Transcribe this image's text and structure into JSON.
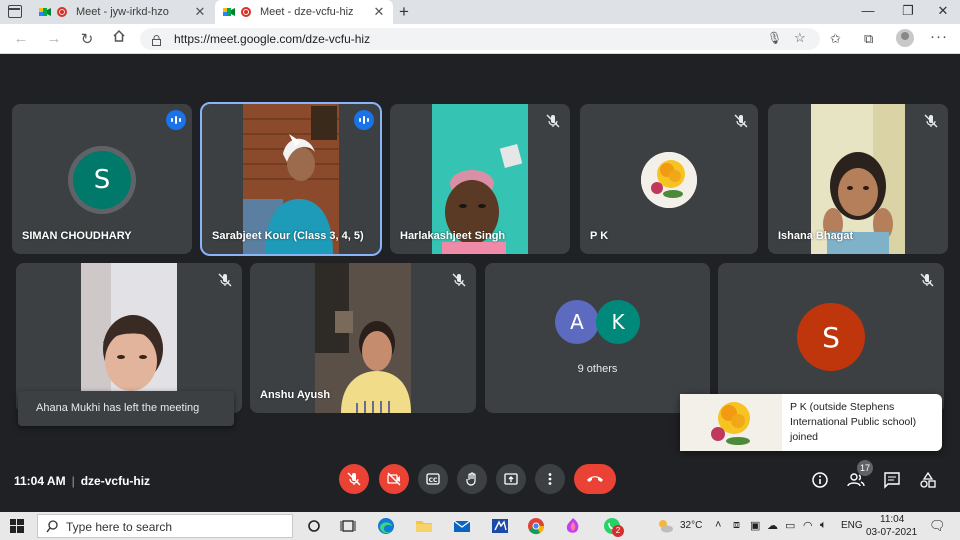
{
  "browser": {
    "tabs": [
      {
        "title": "Meet - jyw-irkd-hzo",
        "active": false
      },
      {
        "title": "Meet - dze-vcfu-hiz",
        "active": true
      }
    ],
    "url": "https://meet.google.com/dze-vcfu-hiz"
  },
  "participants": [
    {
      "name": "SIMAN CHOUDHARY",
      "avatar_letter": "S",
      "avatar_color": "#00796b",
      "status": "speaking"
    },
    {
      "name": "Sarabjeet Kour (Class 3, 4, 5)",
      "status": "speaking",
      "highlighted": true
    },
    {
      "name": "Harlakashjeet Singh",
      "status": "muted"
    },
    {
      "name": "P K",
      "status": "muted"
    },
    {
      "name": "Ishana Bhagat",
      "status": "muted"
    },
    {
      "name": "",
      "status": "muted"
    },
    {
      "name": "Anshu Ayush",
      "status": "muted"
    },
    {
      "name": "9 others",
      "avatars": [
        {
          "letter": "A",
          "color": "#5c6bc0"
        },
        {
          "letter": "K",
          "color": "#00897b"
        }
      ]
    },
    {
      "name": "",
      "avatar_letter": "S",
      "avatar_color": "#bf360c",
      "status": "muted"
    }
  ],
  "notifications": {
    "left": "Ahana Mukhi has left the meeting",
    "right": "P K (outside Stephens International Public school) joined"
  },
  "meeting": {
    "time": "11:04 AM",
    "code": "dze-vcfu-hiz",
    "people_count": "17"
  },
  "taskbar": {
    "search_placeholder": "Type here to search",
    "weather": "32°C",
    "language": "ENG",
    "time": "11:04",
    "date": "03-07-2021",
    "whatsapp_badge": "2"
  },
  "colors": {
    "meet_bg": "#202124",
    "tile_bg": "#3c4043",
    "end_call": "#ea4335",
    "speaking_outline": "#8ab4f8"
  }
}
